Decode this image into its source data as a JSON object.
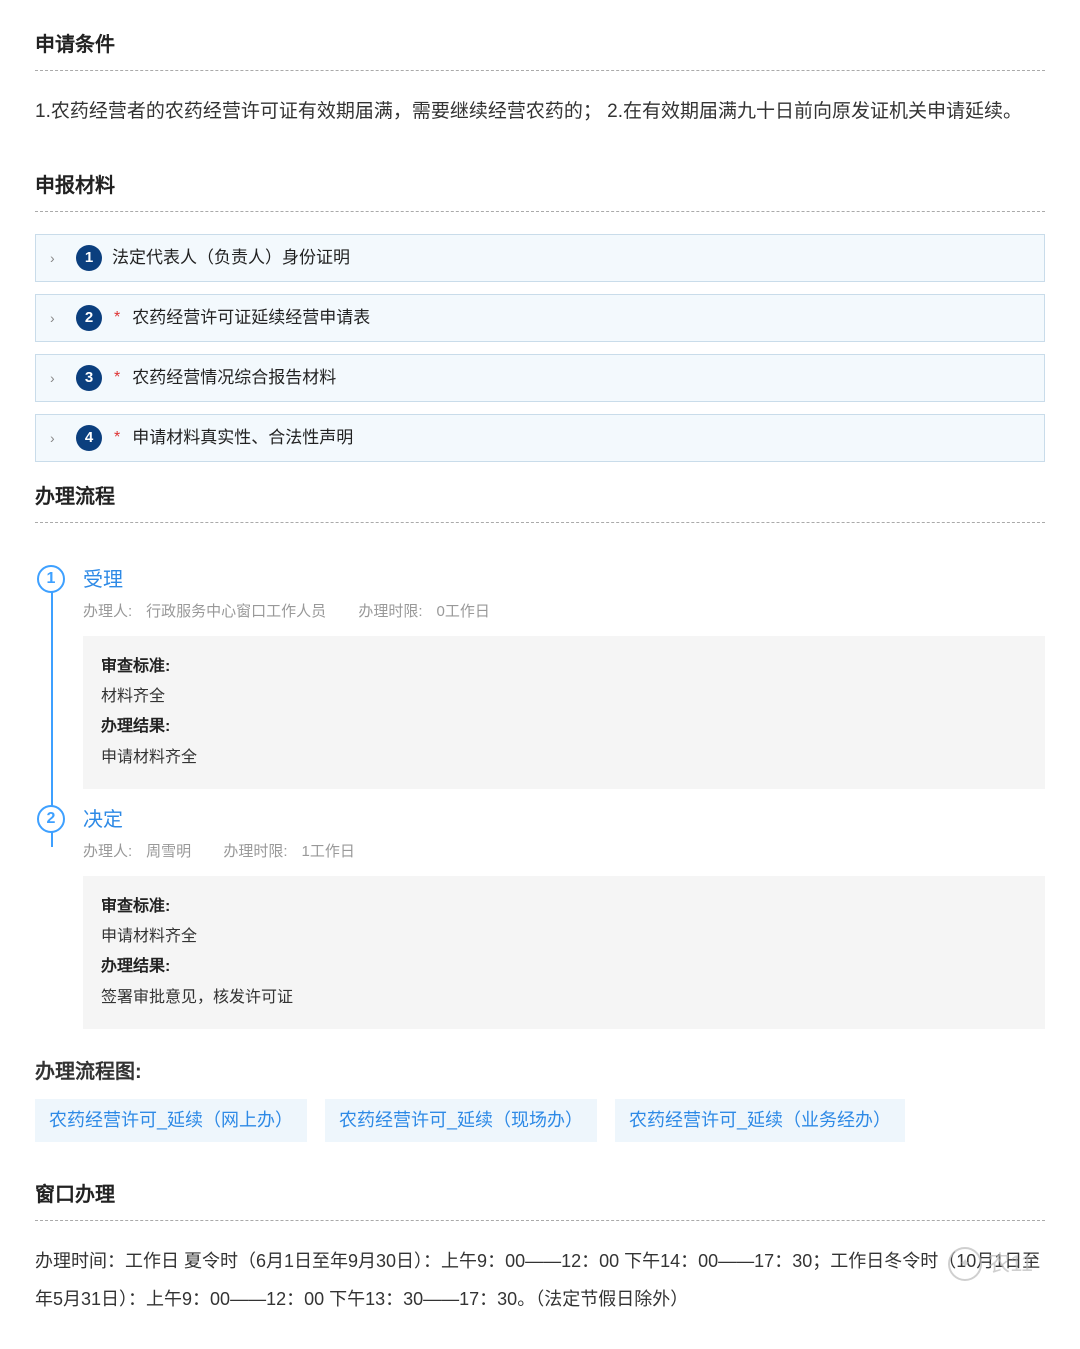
{
  "conditions": {
    "heading": "申请条件",
    "text": "1.农药经营者的农药经营许可证有效期届满，需要继续经营农药的；  2.在有效期届满九十日前向原发证机关申请延续。"
  },
  "materials": {
    "heading": "申报材料",
    "items": [
      {
        "num": "1",
        "required": false,
        "label": "法定代表人（负责人）身份证明"
      },
      {
        "num": "2",
        "required": true,
        "label": "农药经营许可证延续经营申请表"
      },
      {
        "num": "3",
        "required": true,
        "label": "农药经营情况综合报告材料"
      },
      {
        "num": "4",
        "required": true,
        "label": "申请材料真实性、合法性声明"
      }
    ]
  },
  "process": {
    "heading": "办理流程",
    "steps": [
      {
        "num": "1",
        "title": "受理",
        "handler_label": "办理人:",
        "handler_value": "行政服务中心窗口工作人员",
        "limit_label": "办理时限:",
        "limit_value": "0工作日",
        "std_label": "审查标准:",
        "std_value": "材料齐全",
        "result_label": "办理结果:",
        "result_value": "申请材料齐全"
      },
      {
        "num": "2",
        "title": "决定",
        "handler_label": "办理人:",
        "handler_value": "周雪明",
        "limit_label": "办理时限:",
        "limit_value": "1工作日",
        "std_label": "审查标准:",
        "std_value": "申请材料齐全",
        "result_label": "办理结果:",
        "result_value": "签署审批意见，核发许可证"
      }
    ]
  },
  "flowchart": {
    "heading": "办理流程图:",
    "links": [
      "农药经营许可_延续（网上办）",
      "农药经营许可_延续（现场办）",
      "农药经营许可_延续（业务经办）"
    ]
  },
  "windowHandling": {
    "heading": "窗口办理",
    "text": "办理时间：工作日 夏令时（6月1日至年9月30日）：上午9：00——12：00 下午14：00——17：30；工作日冬令时（10月1日至年5月31日）：上午9：00——12：00 下午13：30——17：30。（法定节假日除外）"
  },
  "watermark": {
    "label": "农11"
  }
}
